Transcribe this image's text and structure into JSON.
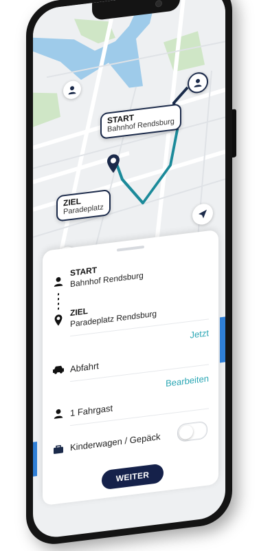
{
  "map": {
    "start_bubble": {
      "label": "START",
      "value": "Bahnhof Rendsburg"
    },
    "end_bubble": {
      "label": "ZIEL",
      "value": "Paradeplatz"
    },
    "colors": {
      "route": "#1b8a9a",
      "route_dark": "#1b2a4a",
      "water": "#9ecbea",
      "park": "#cfe6c6"
    }
  },
  "nav": {
    "back_icon": "arrow-left-icon",
    "locate_icon": "navigation-arrow-icon"
  },
  "sheet": {
    "start_label": "START",
    "start_value": "Bahnhof Rendsburg",
    "destination_label": "ZIEL",
    "destination_value": "Paradeplatz Rendsburg",
    "departure_label": "Abfahrt",
    "departure_action": "Jetzt",
    "passengers_label": "1 Fahrgast",
    "passengers_action": "Bearbeiten",
    "luggage_label": "Kinderwagen / Gepäck",
    "luggage_enabled": false,
    "continue_button": "WEITER"
  },
  "colors": {
    "accent": "#2aa6b4",
    "primary": "#15214a",
    "frame": "#141414"
  }
}
